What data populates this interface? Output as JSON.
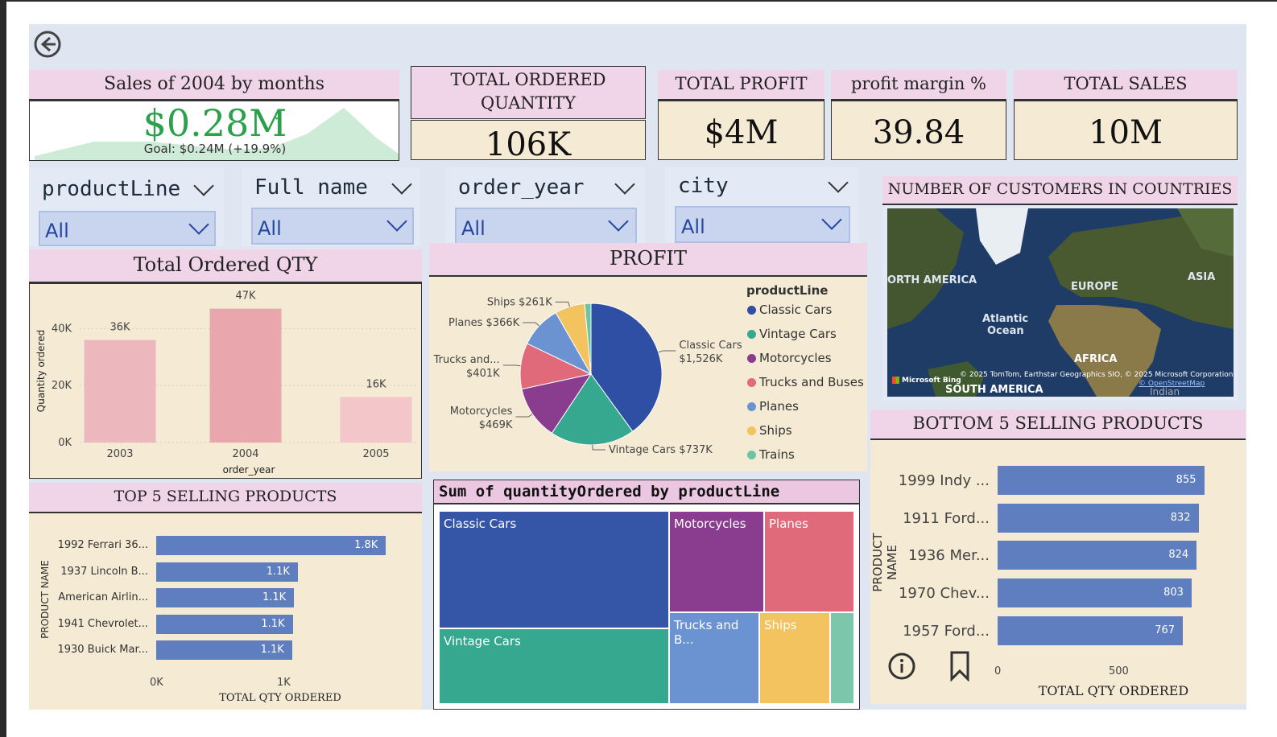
{
  "nav": {
    "back_icon": "back-arrow-circle-icon"
  },
  "sales_card": {
    "title": "Sales of 2004 by months",
    "value": "$0.28M",
    "goal": "Goal: $0.24M (+19.9%)",
    "check_icon": "checkmark-icon"
  },
  "kpis": {
    "total_ordered_quantity": {
      "title": "TOTAL ORDERED QUANTITY",
      "value": "106K"
    },
    "total_profit": {
      "title": "TOTAL PROFIT",
      "value": "$4M"
    },
    "profit_margin": {
      "title": "profit margin %",
      "value": "39.84"
    },
    "total_sales": {
      "title": "TOTAL SALES",
      "value": "10M"
    }
  },
  "slicers": [
    {
      "title": "productLine",
      "value": "All"
    },
    {
      "title": "Full name",
      "value": "All"
    },
    {
      "title": "order_year",
      "value": "All"
    },
    {
      "title": "city",
      "value": "All"
    }
  ],
  "map": {
    "title": "NUMBER OF CUSTOMERS IN COUNTRIES",
    "labels": {
      "north_america": "ORTH AMERICA",
      "europe": "EUROPE",
      "asia": "ASIA",
      "atlantic": "Atlantic",
      "ocean": "Ocean",
      "africa": "AFRICA",
      "south_america": "SOUTH AMERICA",
      "indian": "Indian"
    },
    "bing": "Microsoft Bing",
    "copyright": "© 2025 TomTom, Earthstar Geographics SIO, © 2025 Microsoft Corporation,",
    "osm": "© OpenStreetMap"
  },
  "qty_chart": {
    "title": "Total Ordered QTY",
    "colors": [
      "#ecb8bd",
      "#e9a6ad",
      "#f3c6c9"
    ]
  },
  "profit_chart": {
    "title": "PROFIT",
    "legend_title": "productLine"
  },
  "top5": {
    "title": "TOP 5 SELLING PRODUCTS",
    "ylabel": "PRODUCT NAME",
    "xlabel": "TOTAL QTY ORDERED",
    "ticks": [
      "0K",
      "1K"
    ]
  },
  "treemap": {
    "title": "Sum of quantityOrdered by productLine",
    "cells": [
      "Classic Cars",
      "Motorcycles",
      "Planes",
      "Vintage Cars",
      "Trucks and B...",
      "Ships"
    ]
  },
  "bottom5": {
    "title": "BOTTOM 5 SELLING PRODUCTS",
    "ylabel": "PRODUCT NAME",
    "xlabel": "TOTAL QTY ORDERED",
    "ticks": [
      "0",
      "500"
    ],
    "info_icon": "info-circle-icon",
    "bookmark_icon": "bookmark-icon"
  },
  "chart_data": [
    {
      "type": "bar",
      "title": "Total Ordered QTY",
      "categories": [
        "2003",
        "2004",
        "2005"
      ],
      "values": [
        36000,
        47000,
        16000
      ],
      "data_labels": [
        "36K",
        "47K",
        "16K"
      ],
      "xlabel": "order_year",
      "ylabel": "Quantity ordered",
      "yticks": [
        "0K",
        "20K",
        "40K"
      ],
      "ylim": [
        0,
        50000
      ],
      "grid": true
    },
    {
      "type": "pie",
      "title": "PROFIT",
      "legend_title": "productLine",
      "legend_position": "right",
      "labels": [
        "Classic Cars",
        "Vintage Cars",
        "Motorcycles",
        "Trucks and Buses",
        "Planes",
        "Ships",
        "Trains"
      ],
      "values": [
        1526,
        737,
        469,
        401,
        366,
        261,
        55
      ],
      "slice_labels": [
        "Classic Cars $1,526K",
        "Vintage Cars $737K",
        "Motorcycles $469K",
        "Trucks and... $401K",
        "Planes $366K",
        "Ships $261K",
        ""
      ],
      "colors": [
        "#2e4fa3",
        "#35a88f",
        "#8a3d8f",
        "#e06a7a",
        "#6b93d2",
        "#f2c35e",
        "#6cc4a4"
      ]
    },
    {
      "type": "bar",
      "orientation": "horizontal",
      "title": "TOP 5 SELLING PRODUCTS",
      "categories": [
        "1992 Ferrari 36...",
        "1937 Lincoln B...",
        "American Airlin...",
        "1941 Chevrolet...",
        "1930 Buick Mar..."
      ],
      "values": [
        1800,
        1110,
        1080,
        1070,
        1065
      ],
      "data_labels": [
        "1.8K",
        "1.1K",
        "1.1K",
        "1.1K",
        "1.1K"
      ],
      "xlabel": "TOTAL QTY ORDERED",
      "ylabel": "PRODUCT NAME",
      "xlim": [
        0,
        2000
      ]
    },
    {
      "type": "treemap",
      "title": "Sum of quantityOrdered by productLine",
      "labels": [
        "Classic Cars",
        "Vintage Cars",
        "Motorcycles",
        "Planes",
        "Trucks and B...",
        "Ships",
        "Trains"
      ],
      "values": [
        35000,
        22000,
        12000,
        11000,
        10000,
        8000,
        2700
      ],
      "colors": [
        "#3556a6",
        "#35a88f",
        "#8a3d8f",
        "#e06a7a",
        "#6b93d2",
        "#f2c35e",
        "#7cc7ab"
      ]
    },
    {
      "type": "bar",
      "orientation": "horizontal",
      "title": "BOTTOM 5 SELLING PRODUCTS",
      "categories": [
        "1999 Indy ...",
        "1911 Ford...",
        "1936 Mer...",
        "1970 Chev...",
        "1957 Ford..."
      ],
      "values": [
        855,
        832,
        824,
        803,
        767
      ],
      "data_labels": [
        "855",
        "832",
        "824",
        "803",
        "767"
      ],
      "xlabel": "TOTAL QTY ORDERED",
      "ylabel": "PRODUCT NAME",
      "xlim": [
        0,
        1000
      ]
    }
  ]
}
